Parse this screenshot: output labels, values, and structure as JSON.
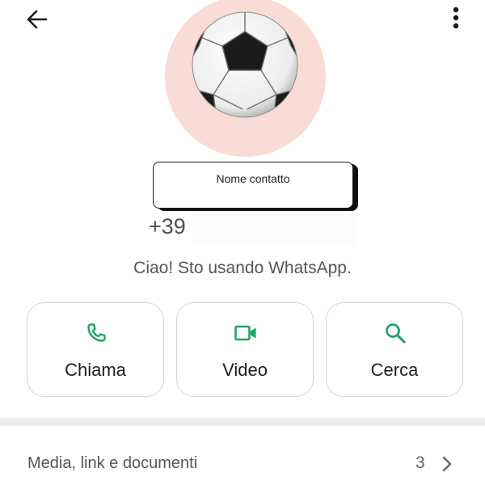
{
  "header": {
    "back_icon": "arrow-back-icon",
    "menu_icon": "more-vert-icon"
  },
  "profile": {
    "avatar_icon": "soccer-ball-icon",
    "avatar_bg_color": "#f9dcd5",
    "name": "Nome contatto",
    "phone": "+39",
    "status": "Ciao! Sto usando WhatsApp."
  },
  "actions": [
    {
      "label": "Chiama",
      "icon": "phone-icon"
    },
    {
      "label": "Video",
      "icon": "videocam-icon"
    },
    {
      "label": "Cerca",
      "icon": "search-icon"
    }
  ],
  "accent_color": "#21a366",
  "media": {
    "label": "Media, link e documenti",
    "count": "3",
    "icon": "chevron-right-icon"
  }
}
